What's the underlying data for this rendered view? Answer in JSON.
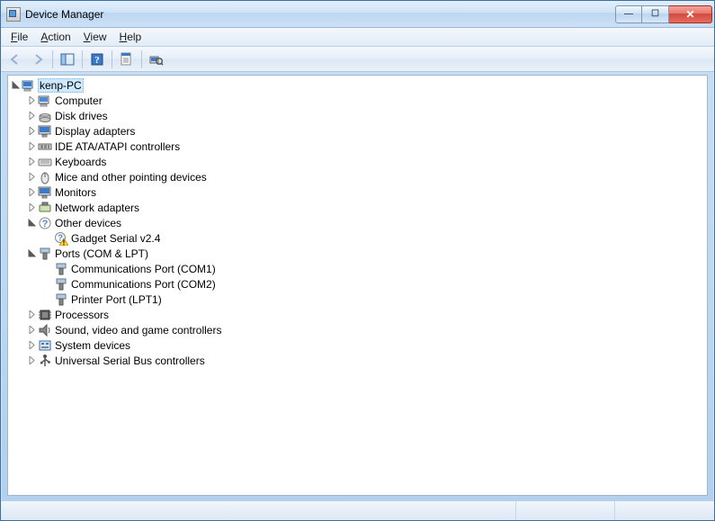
{
  "window": {
    "title": "Device Manager"
  },
  "menus": {
    "file": "File",
    "action": "Action",
    "view": "View",
    "help": "Help"
  },
  "toolbar": {
    "back": "Back",
    "forward": "Forward",
    "show_hide": "Show/Hide Console Tree",
    "help": "Help",
    "properties": "Properties",
    "scan": "Scan for hardware changes"
  },
  "tree": {
    "root": {
      "label": "kenp-PC",
      "expanded": true,
      "icon": "computer-root-icon"
    },
    "children": [
      {
        "label": "Computer",
        "icon": "computer-icon",
        "expandable": true
      },
      {
        "label": "Disk drives",
        "icon": "disk-icon",
        "expandable": true
      },
      {
        "label": "Display adapters",
        "icon": "display-icon",
        "expandable": true
      },
      {
        "label": "IDE ATA/ATAPI controllers",
        "icon": "ide-icon",
        "expandable": true
      },
      {
        "label": "Keyboards",
        "icon": "keyboard-icon",
        "expandable": true
      },
      {
        "label": "Mice and other pointing devices",
        "icon": "mouse-icon",
        "expandable": true
      },
      {
        "label": "Monitors",
        "icon": "monitor-icon",
        "expandable": true
      },
      {
        "label": "Network adapters",
        "icon": "network-icon",
        "expandable": true
      },
      {
        "label": "Other devices",
        "icon": "other-icon",
        "expandable": true,
        "expanded": true,
        "children": [
          {
            "label": "Gadget Serial v2.4",
            "icon": "other-warn-icon",
            "expandable": false
          }
        ]
      },
      {
        "label": "Ports (COM & LPT)",
        "icon": "port-icon",
        "expandable": true,
        "expanded": true,
        "children": [
          {
            "label": "Communications Port (COM1)",
            "icon": "port-icon",
            "expandable": false
          },
          {
            "label": "Communications Port (COM2)",
            "icon": "port-icon",
            "expandable": false
          },
          {
            "label": "Printer Port (LPT1)",
            "icon": "port-icon",
            "expandable": false
          }
        ]
      },
      {
        "label": "Processors",
        "icon": "processor-icon",
        "expandable": true
      },
      {
        "label": "Sound, video and game controllers",
        "icon": "sound-icon",
        "expandable": true
      },
      {
        "label": "System devices",
        "icon": "system-icon",
        "expandable": true
      },
      {
        "label": "Universal Serial Bus controllers",
        "icon": "usb-icon",
        "expandable": true
      }
    ]
  }
}
